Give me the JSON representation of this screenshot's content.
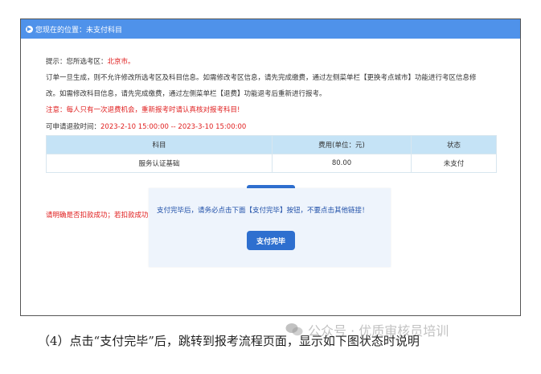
{
  "breadcrumb": "您现在的位置：未支付科目",
  "notice": {
    "hint_prefix": "提示：您所选考区：",
    "hint_city": "北京市。",
    "order_line1": "订单一旦生成，则不允许修改所选考区及科目信息。如需修改考区信息，请先完成缴费，通过左侧菜单栏【更换考点城市】功能进行考区信息修",
    "order_line2": "改。如需修改科目信息，请先完成缴费，通过左侧菜单栏【退费】功能退考后重新进行报考。",
    "attention": "注意：每人只有一次退费机会，重新报考时请认真核对报考科目!",
    "refund_label": "可申请退款时间：",
    "refund_range": "2023-2-10 15:00:00 -- 2023-3-10 15:00:00"
  },
  "table": {
    "headers": [
      "科目",
      "费用(单位：元)",
      "状态"
    ],
    "rows": [
      [
        "服务认证基础",
        "80.00",
        "未支付"
      ]
    ]
  },
  "warning": "请明确是否扣款成功；若扣款成功",
  "popup": {
    "message": "支付完毕后，请务必点击下面【支付完毕】按钮，不要点击其他链接！",
    "button": "支付完毕"
  },
  "caption": "（4）点击“支付完毕”后，跳转到报考流程页面，显示如下图状态时说明",
  "watermark": "公众号 · 优质审核员培训",
  "colors": {
    "topbar": "#4f92ea",
    "table_header": "#c5e3f6",
    "button": "#2e6fcf",
    "alert": "#e02020"
  }
}
